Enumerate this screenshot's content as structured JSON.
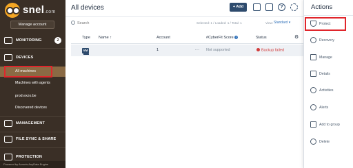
{
  "app": {
    "logo_text": "snel",
    "logo_domain": ".com",
    "manage_account_label": "Manage account"
  },
  "sidebar": {
    "sections": {
      "monitoring": {
        "label": "MONITORING",
        "badge": "2"
      },
      "devices": {
        "label": "DEVICES"
      },
      "management": {
        "label": "MANAGEMENT"
      },
      "file_sync": {
        "label": "FILE SYNC & SHARE"
      },
      "protection": {
        "label": "PROTECTION"
      }
    },
    "device_items": [
      {
        "label": "All machines",
        "active": true
      },
      {
        "label": "Machines with agents",
        "active": false
      },
      {
        "label": "prod.exzo.be",
        "active": false
      },
      {
        "label": "Discovered devices",
        "active": false
      }
    ],
    "footer": "Powered by Acronis AnyData Engine"
  },
  "main": {
    "title": "All devices",
    "add_button": "+ Add",
    "help_glyph": "?",
    "search_placeholder": "Search",
    "selection_info": "Selected: 1 / Loaded: 1 / Total: 1",
    "view_label": "View:",
    "view_value": "Standard",
    "columns": {
      "type": "Type",
      "name": "Name ↑",
      "account": "Account",
      "cyberfit": "#CyberFit Score",
      "status": "Status"
    },
    "rows": [
      {
        "type_badge": "VM",
        "name": "",
        "account": "1",
        "ellipsis": "...",
        "cyberfit": "Not supported",
        "status": "Backup failed"
      }
    ]
  },
  "actions_panel": {
    "title": "Actions",
    "items": [
      {
        "label": "Protect",
        "icon": "shield-icon"
      },
      {
        "label": "Recovery",
        "icon": "recovery-icon"
      },
      {
        "label": "Manage",
        "icon": "manage-icon"
      },
      {
        "label": "Details",
        "icon": "details-icon"
      },
      {
        "label": "Activities",
        "icon": "activities-icon"
      },
      {
        "label": "Alerts",
        "icon": "alert-icon"
      },
      {
        "label": "Add to group",
        "icon": "add-to-group-icon"
      },
      {
        "label": "Delete",
        "icon": "delete-icon"
      }
    ]
  },
  "colors": {
    "sidebar_bg": "#3a2f26",
    "sidebar_active": "#8a6a44",
    "primary": "#2e4b6d",
    "error": "#d23c3c",
    "highlight": "#e0262c"
  }
}
